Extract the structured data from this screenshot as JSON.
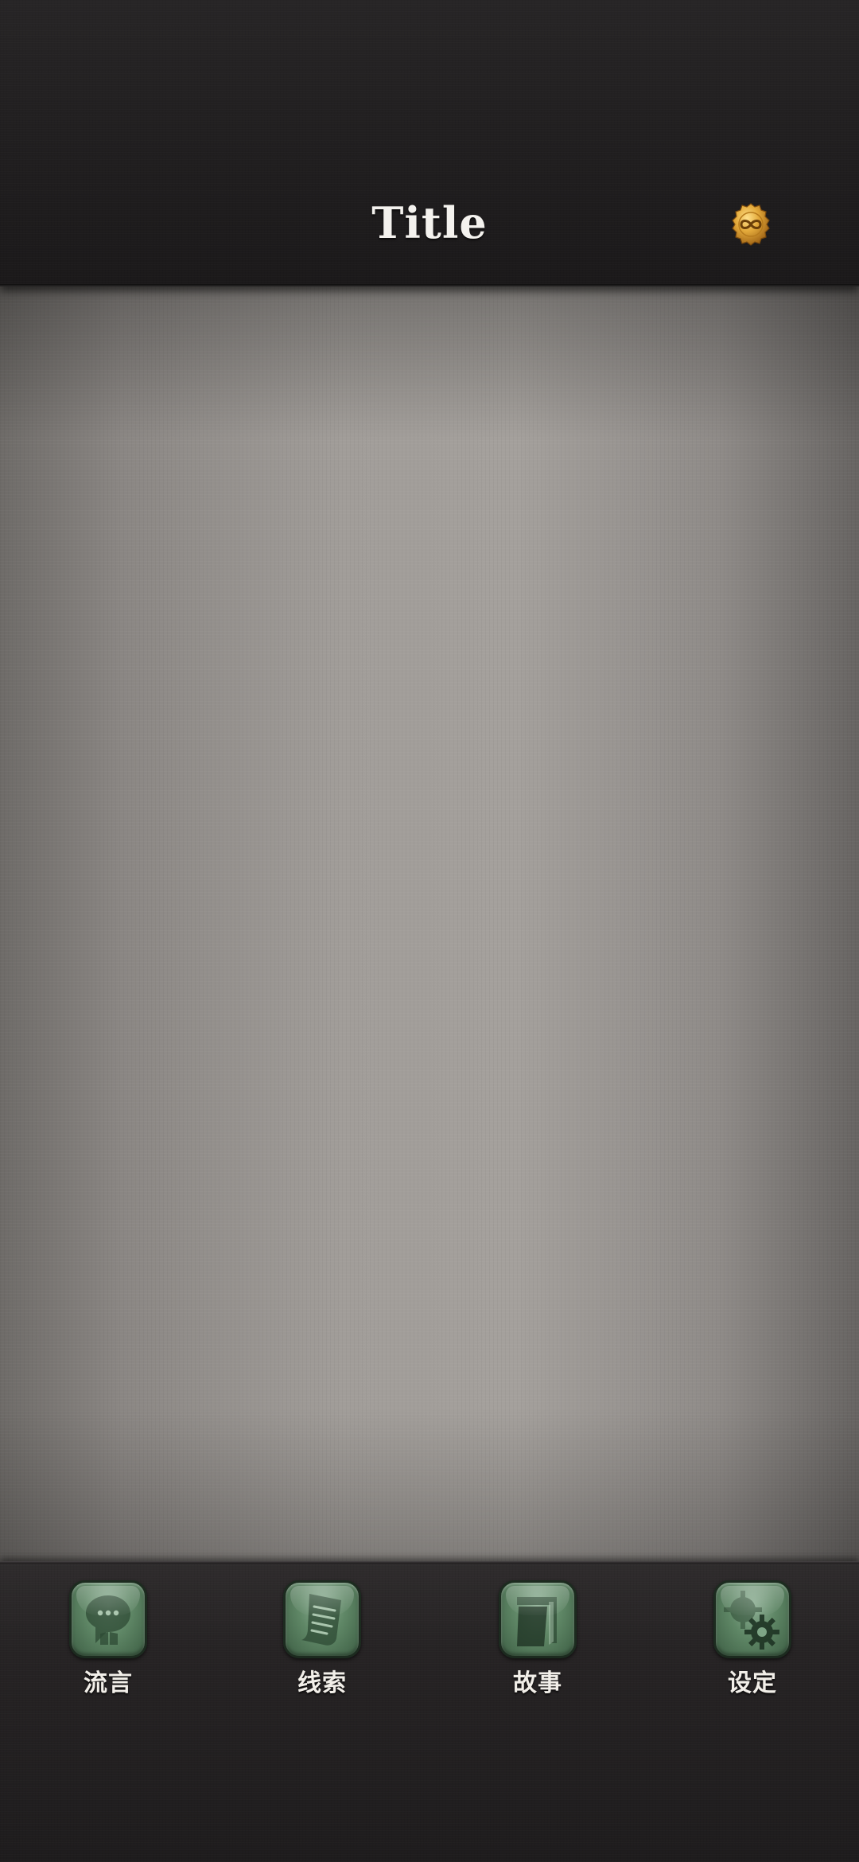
{
  "header": {
    "title": "Title",
    "coin_icon": "infinity-coin-icon"
  },
  "bottom_nav": {
    "items": [
      {
        "label": "流言",
        "icon": "speech-bubble-icon"
      },
      {
        "label": "线索",
        "icon": "paper-scroll-icon"
      },
      {
        "label": "故事",
        "icon": "book-icon"
      },
      {
        "label": "设定",
        "icon": "gears-icon"
      }
    ]
  },
  "colors": {
    "header_bg": "#201e1f",
    "canvas_bg": "#a19d99",
    "nav_bg": "#262324",
    "icon_green": "#5f8766",
    "coin_gold": "#d39a2c",
    "text_light": "#f4f2ee"
  }
}
